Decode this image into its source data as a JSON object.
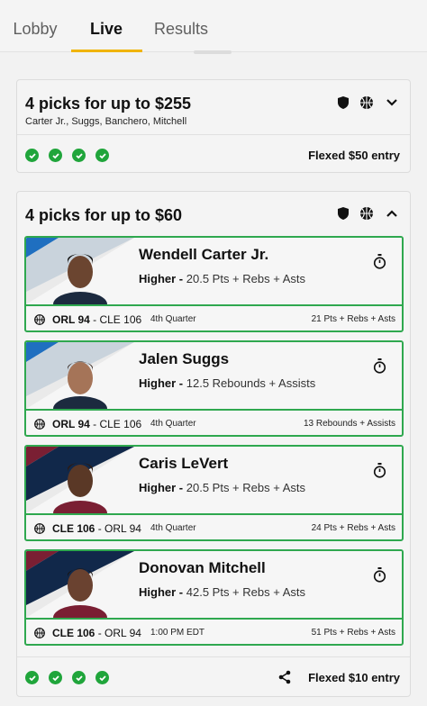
{
  "tabs": [
    {
      "label": "Lobby"
    },
    {
      "label": "Live"
    },
    {
      "label": "Results"
    }
  ],
  "entry1": {
    "title": "4 picks for up to $255",
    "players": "Carter Jr., Suggs, Banchero, Mitchell",
    "entry_label": "Flexed $50 entry",
    "header_icons": [
      "shield-icon",
      "basketball-icon",
      "chevron-down-icon"
    ],
    "checks": 4
  },
  "entry2": {
    "title": "4 picks for up to $60",
    "entry_label": "Flexed $10 entry",
    "header_icons": [
      "shield-icon",
      "basketball-icon",
      "chevron-up-icon"
    ],
    "footer_icons": [
      "share-icon"
    ],
    "checks": 4,
    "picks": [
      {
        "name": "Wendell Carter Jr.",
        "direction": "Higher -",
        "line": "20.5 Pts + Rebs + Asts",
        "team": "ORL 94",
        "matchup": " - CLE 106",
        "period": "4th Quarter",
        "stat": "21 Pts + Rebs + Asts",
        "team_colors": [
          "#1f6fc0",
          "#c9d3dc"
        ]
      },
      {
        "name": "Jalen Suggs",
        "direction": "Higher -",
        "line": "12.5 Rebounds + Assists",
        "team": "ORL 94",
        "matchup": " - CLE 106",
        "period": "4th Quarter",
        "stat": "13 Rebounds + Assists",
        "team_colors": [
          "#1f6fc0",
          "#c9d3dc"
        ]
      },
      {
        "name": "Caris LeVert",
        "direction": "Higher -",
        "line": "20.5 Pts + Rebs + Asts",
        "team": "CLE 106",
        "matchup": " - ORL 94",
        "period": "4th Quarter",
        "stat": "24 Pts + Rebs + Asts",
        "team_colors": [
          "#7a1f33",
          "#11284a"
        ]
      },
      {
        "name": "Donovan Mitchell",
        "direction": "Higher -",
        "line": "42.5 Pts + Rebs + Asts",
        "team": "CLE 106",
        "matchup": " - ORL 94",
        "period": "1:00 PM EDT",
        "stat": "51 Pts + Rebs + Asts",
        "team_colors": [
          "#7a1f33",
          "#11284a"
        ]
      }
    ]
  },
  "colors": {
    "accent": "#f0b400",
    "success": "#20a53b",
    "pick_border": "#2fa84f"
  }
}
